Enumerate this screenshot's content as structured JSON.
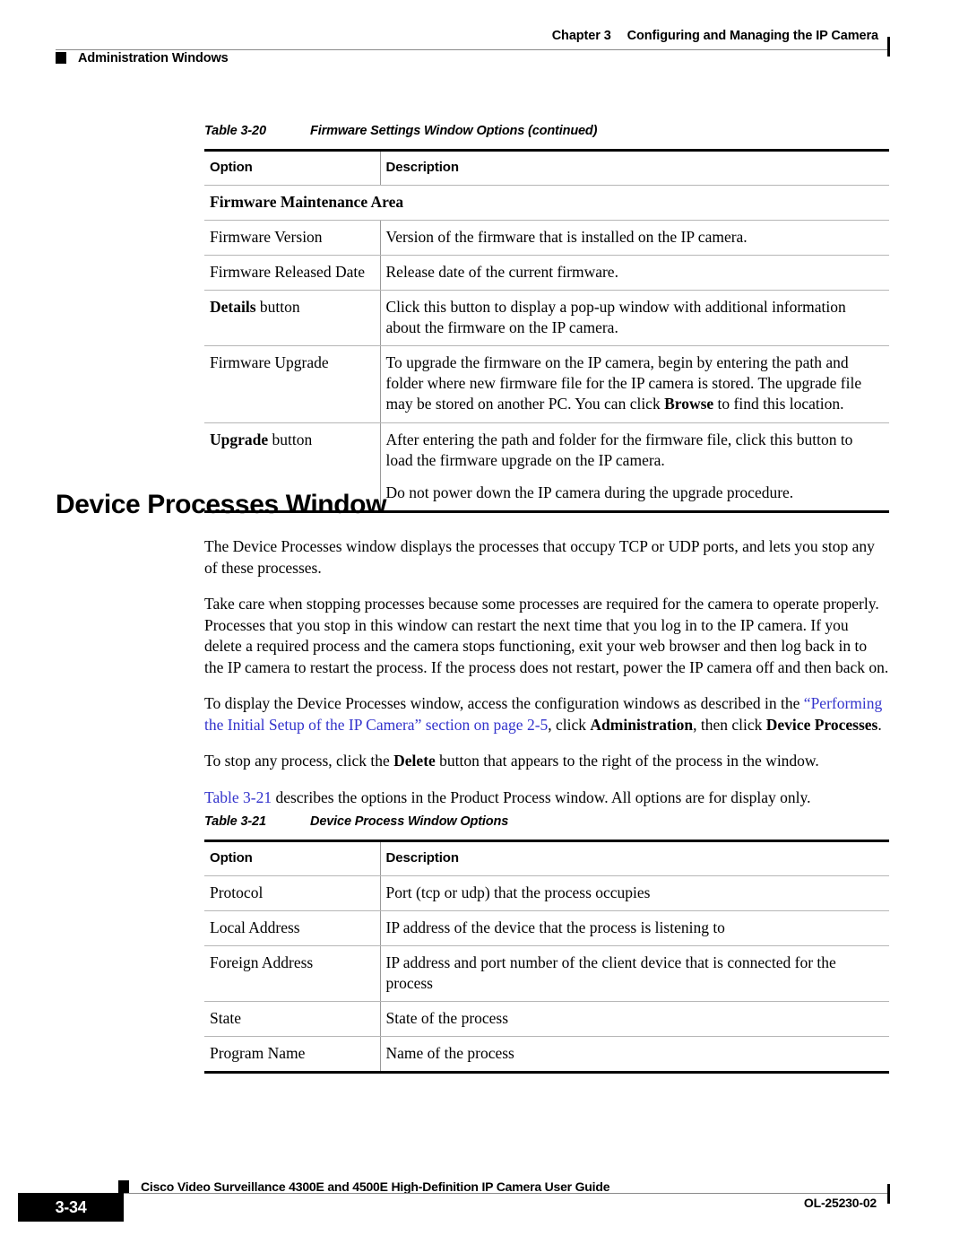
{
  "header": {
    "chapter_label": "Chapter 3",
    "chapter_title": "Configuring and Managing the IP Camera",
    "section": "Administration Windows"
  },
  "table_3_20": {
    "caption_number": "Table 3-20",
    "caption_title": "Firmware Settings Window Options (continued)",
    "columns": [
      "Option",
      "Description"
    ],
    "section_row": "Firmware Maintenance Area",
    "rows": [
      {
        "option": "Firmware Version",
        "option_bold": "",
        "option_tail": "",
        "description": [
          "Version of the firmware that is installed on the IP camera."
        ]
      },
      {
        "option": "Firmware Released Date",
        "option_bold": "",
        "option_tail": "",
        "description": [
          "Release date of the current firmware."
        ]
      },
      {
        "option": "",
        "option_bold": "Details",
        "option_tail": " button",
        "description": [
          "Click this button to display a pop-up window with additional information about the firmware on the IP camera."
        ]
      },
      {
        "option": "Firmware Upgrade",
        "option_bold": "",
        "option_tail": "",
        "description": [
          "To upgrade the firmware on the IP camera, begin by entering the path and folder where new firmware file for the IP camera is stored. The upgrade file may be stored on another PC. You can click Browse to find this location."
        ]
      },
      {
        "option": "",
        "option_bold": "Upgrade",
        "option_tail": " button",
        "description": [
          "After entering the path and folder for the firmware file, click this button to load the firmware upgrade on the IP camera.",
          "Do not power down the IP camera during the upgrade procedure."
        ]
      }
    ]
  },
  "section_heading": "Device Processes Window",
  "paragraphs": {
    "p1": "The Device Processes window displays the processes that occupy TCP or UDP ports, and lets you stop any of these processes.",
    "p2": "Take care when stopping processes because some processes are required for the camera to operate properly. Processes that you stop in this window can restart the next time that you log in to the IP camera. If you delete a required process and the camera stops functioning, exit your web browser and then log back in to the IP camera to restart the process. If the process does not restart, power the IP camera off and then back on.",
    "p3_lead": "To display the Device Processes window, access the configuration windows as described in the ",
    "p3_link": "“Performing the Initial Setup of the IP Camera” section on page 2-5",
    "p3_mid": ", click ",
    "p3_bold1": "Administration",
    "p3_mid2": ", then click ",
    "p3_bold2": "Device Processes",
    "p3_end": ".",
    "p4_lead": "To stop any process, click the ",
    "p4_bold": "Delete",
    "p4_end": " button that appears to the right of the process in the window.",
    "p5_link": "Table 3-21",
    "p5_end": " describes the options in the Product Process window. All options are for display only."
  },
  "table_3_21": {
    "caption_number": "Table 3-21",
    "caption_title": "Device Process Window Options",
    "columns": [
      "Option",
      "Description"
    ],
    "rows": [
      {
        "option": "Protocol",
        "description": "Port (tcp or udp) that the process occupies"
      },
      {
        "option": "Local Address",
        "description": "IP address of the device that the process is listening to"
      },
      {
        "option": "Foreign Address",
        "description": "IP address and port number of the client device that is connected for the process"
      },
      {
        "option": "State",
        "description": "State of the process"
      },
      {
        "option": "Program Name",
        "description": "Name of the process"
      }
    ]
  },
  "footer": {
    "guide_title": "Cisco Video Surveillance 4300E and 4500E High-Definition IP Camera User Guide",
    "page_number": "3-34",
    "doc_id": "OL-25230-02"
  },
  "colors": {
    "link": "#3333CC",
    "rule": "#8A8A8A",
    "row_rule": "#B6B6B6"
  }
}
